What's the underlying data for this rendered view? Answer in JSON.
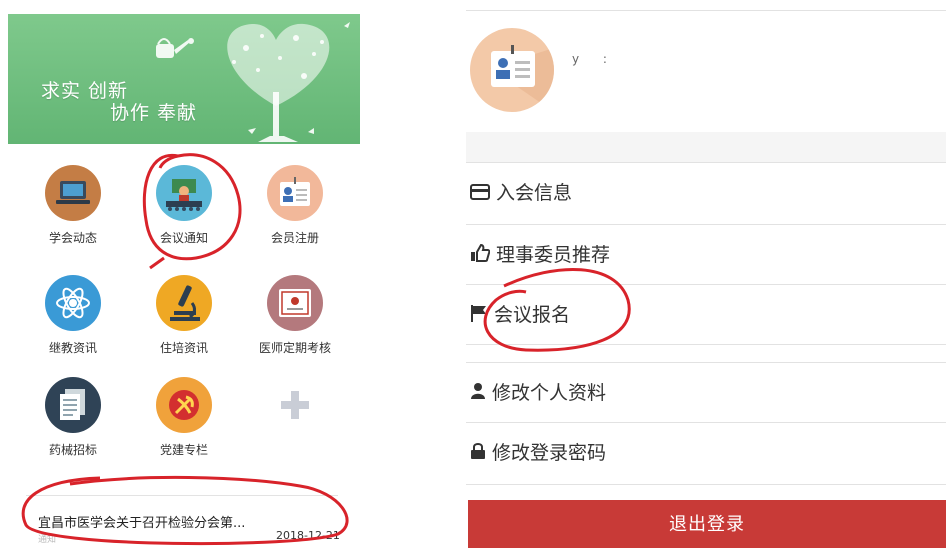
{
  "left": {
    "banner": {
      "line1": "求实 创新",
      "line2": "协作 奉献"
    },
    "grid": [
      {
        "label": "学会动态",
        "icon": "laptop-icon",
        "color": "#c47d45"
      },
      {
        "label": "会议通知",
        "icon": "meeting-icon",
        "color": "#5bb8d8"
      },
      {
        "label": "会员注册",
        "icon": "id-card-icon",
        "color": "#f2b89a"
      },
      {
        "label": "继教资讯",
        "icon": "atom-icon",
        "color": "#3a9ad6"
      },
      {
        "label": "住培资讯",
        "icon": "microscope-icon",
        "color": "#efa824"
      },
      {
        "label": "医师定期考核",
        "icon": "certificate-icon",
        "color": "#b4797d"
      },
      {
        "label": "药械招标",
        "icon": "documents-icon",
        "color": "#2f4356"
      },
      {
        "label": "党建专栏",
        "icon": "party-emblem-icon",
        "color": "#f0a23b"
      },
      {
        "label": "",
        "icon": "plus-icon",
        "color": "#c9cdd6"
      }
    ],
    "news": {
      "title": "宜昌市医学会关于召开检验分会第...",
      "date": "2018-12-21",
      "sub": "通知"
    }
  },
  "right": {
    "profile": {
      "username": "y  :"
    },
    "menu": [
      {
        "label": "入会信息",
        "icon": "card-icon"
      },
      {
        "label": "理事委员推荐",
        "icon": "thumbs-up-icon"
      },
      {
        "label": "会议报名",
        "icon": "flag-icon"
      },
      {
        "label": "修改个人资料",
        "icon": "user-icon"
      },
      {
        "label": "修改登录密码",
        "icon": "lock-icon"
      }
    ],
    "logout": "退出登录"
  },
  "colors": {
    "banner": "#6bbb7b",
    "logout": "#c83a37",
    "annotation": "#d8232a"
  }
}
